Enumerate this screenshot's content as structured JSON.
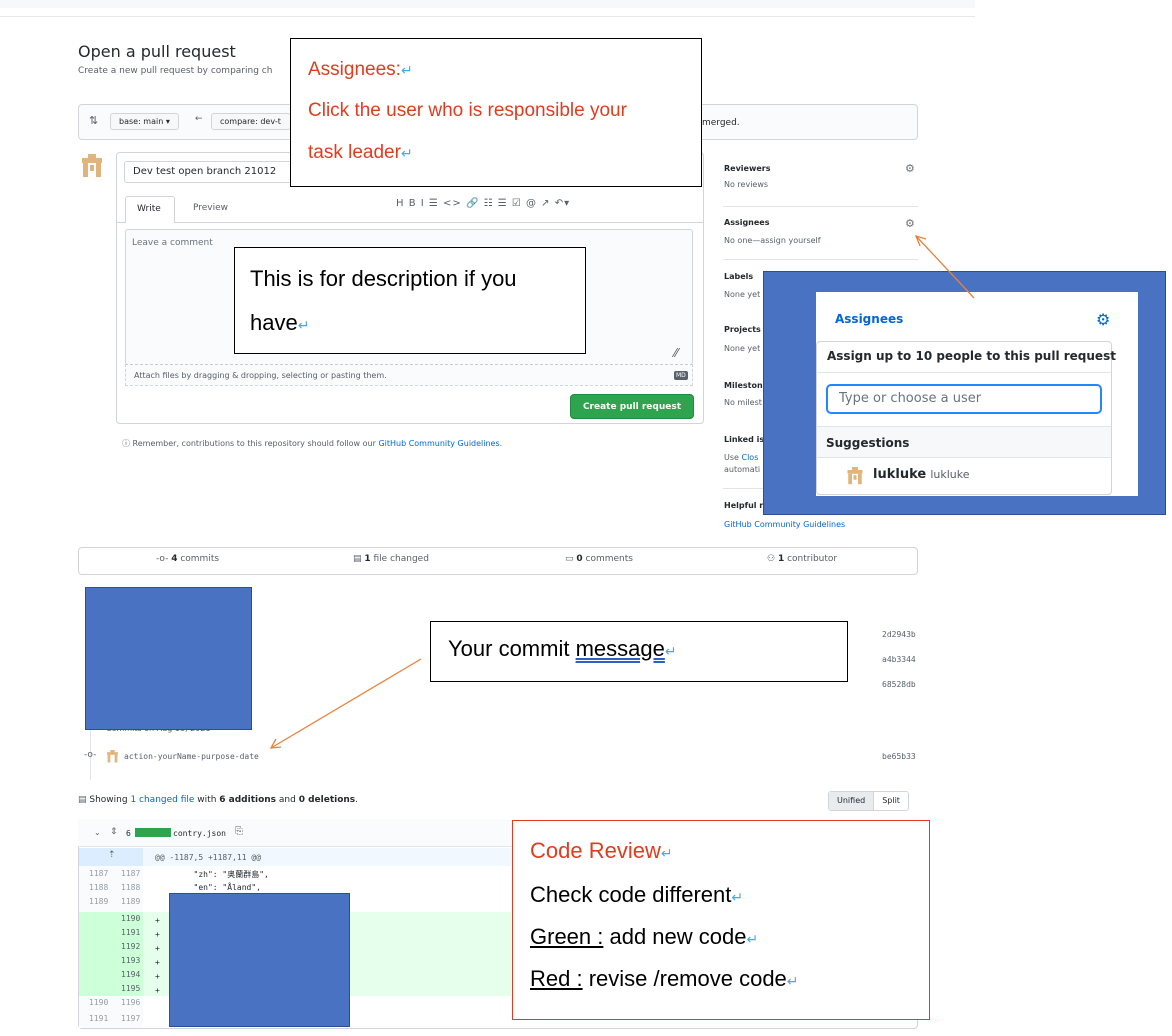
{
  "page": {
    "title": "Open a pull request",
    "subtitle": "Create a new pull request by comparing ch"
  },
  "range": {
    "base_label": "base: main ▾",
    "compare_label": "compare: dev-t",
    "status_tail": "merged."
  },
  "composer": {
    "title_value": "Dev test open branch 21012",
    "tabs": [
      "Write",
      "Preview"
    ],
    "toolbar": "H  B  I   ☰  <>  🔗   ☷  ☰  ☑   @  ↗  ↶▾",
    "placeholder": "Leave a comment",
    "attach_text": "Attach files by dragging & dropping, selecting or pasting them.",
    "attach_badge": "MD",
    "create_button": "Create pull request",
    "remember_prefix": "ⓘ Remember, contributions to this repository should follow our ",
    "remember_link": "GitHub Community Guidelines",
    "remember_suffix": "."
  },
  "sidebar": {
    "reviewers": {
      "title": "Reviewers",
      "value": "No reviews"
    },
    "assignees": {
      "title": "Assignees",
      "value": "No one—assign yourself"
    },
    "labels": {
      "title": "Labels",
      "value": "None yet"
    },
    "projects": {
      "title": "Projects",
      "value": "None yet"
    },
    "milestone": {
      "title": "Mileston",
      "value": "No milest"
    },
    "linked": {
      "title": "Linked is",
      "value_a": "Use ",
      "value_link": "Clos",
      "value_b": "automati"
    },
    "helpful": {
      "title": "Helpful r",
      "link": "GitHub Community Guidelines"
    }
  },
  "stats": {
    "commits": {
      "count": "4",
      "label": " commits"
    },
    "files": {
      "count": "1",
      "label": " file changed"
    },
    "comments": {
      "count": "0",
      "label": " comments"
    },
    "contributors": {
      "count": "1",
      "label": " contributor"
    }
  },
  "commits": {
    "shas": [
      "2d2943b",
      "a4b3344",
      "68528db"
    ],
    "group_label": "Commits on Aug 18, 2021",
    "last_message": "action-yourName-purpose-date",
    "last_sha": "be65b33"
  },
  "files": {
    "showing_prefix": "Showing ",
    "showing_link": "1 changed file",
    "showing_mid": " with ",
    "additions": "6 additions",
    "and": " and ",
    "deletions": "0 deletions",
    "end": ".",
    "toggle": [
      "Unified",
      "Split"
    ],
    "file_count": "6",
    "file_name": "contry.json",
    "hunk_header": "@@ -1187,5 +1187,11 @@",
    "context_lines": [
      {
        "old": "1187",
        "new": "1187",
        "code": "        \"zh\": \"奥蘭群島\","
      },
      {
        "old": "1188",
        "new": "1188",
        "code": "        \"en\": \"Åland\","
      },
      {
        "old": "1189",
        "new": "1189",
        "code": ""
      }
    ],
    "added_lines": [
      "1190",
      "1191",
      "1192",
      "1193",
      "1194",
      "1195"
    ],
    "tail_lines": [
      {
        "old": "1190",
        "new": "1196"
      },
      {
        "old": "1191",
        "new": "1197"
      }
    ]
  },
  "popover": {
    "title": "Assignees",
    "header": "Assign up to 10 people to this pull request",
    "input_placeholder": "Type or choose a user",
    "suggestions_label": "Suggestions",
    "user_login": "lukluke",
    "user_name": "lukluke"
  },
  "callouts": {
    "assignees": {
      "heading": "Assignees:",
      "line1": "Click the user who is responsible your",
      "line2": "task leader"
    },
    "description": {
      "line1": "This is for description if you",
      "line2": "have"
    },
    "commit": {
      "prefix": "Your commit ",
      "underlined": "message"
    },
    "review": {
      "heading": "Code Review",
      "line1": "Check code different",
      "green_label": "Green :",
      "green_text": " add new code",
      "red_label": "Red :",
      "red_text": " revise /remove code"
    },
    "return_mark": "↵"
  },
  "colors": {
    "annotation_red": "#e03c1f",
    "mask_blue": "#4a72c2",
    "arrow": "#e8823a",
    "github_green": "#2ea44f"
  }
}
